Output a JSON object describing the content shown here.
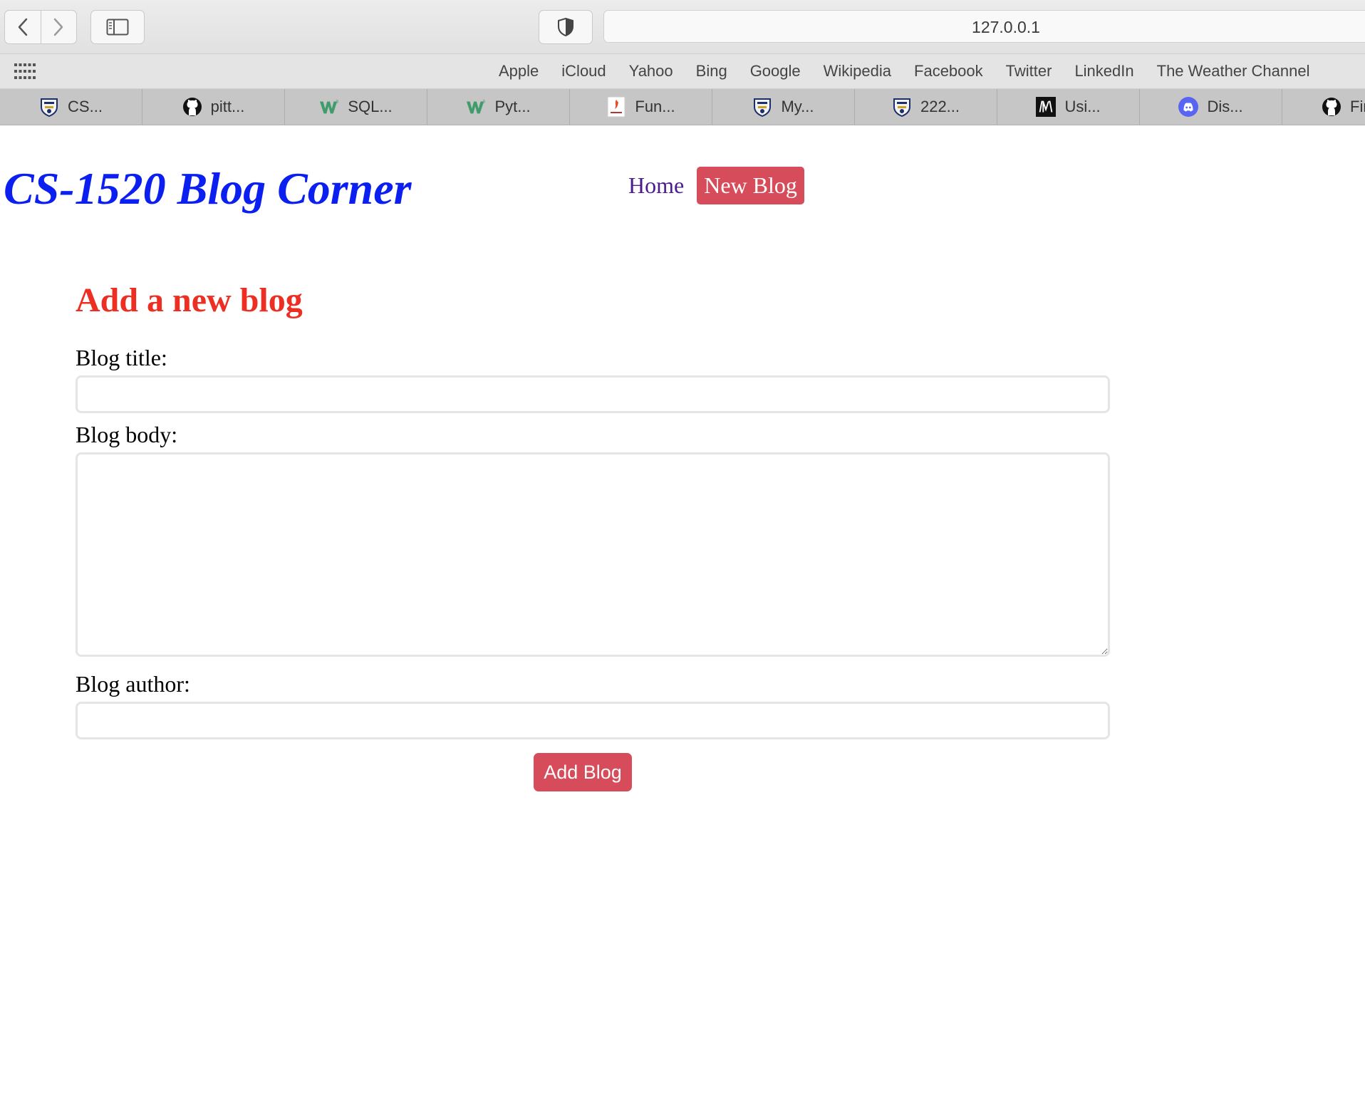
{
  "browser": {
    "address": "127.0.0.1",
    "favorites": [
      "Apple",
      "iCloud",
      "Yahoo",
      "Bing",
      "Google",
      "Wikipedia",
      "Facebook",
      "Twitter",
      "LinkedIn",
      "The Weather Channel"
    ],
    "tabs": [
      {
        "label": "CS...",
        "icon": "university-shield-icon"
      },
      {
        "label": "pitt...",
        "icon": "github-icon"
      },
      {
        "label": "SQL...",
        "icon": "w3schools-icon"
      },
      {
        "label": "Pyt...",
        "icon": "w3schools-icon"
      },
      {
        "label": "Fun...",
        "icon": "book-cover-icon"
      },
      {
        "label": "My...",
        "icon": "university-shield-icon"
      },
      {
        "label": "222...",
        "icon": "university-shield-icon"
      },
      {
        "label": "Usi...",
        "icon": "medium-icon"
      },
      {
        "label": "Dis...",
        "icon": "discord-icon"
      },
      {
        "label": "Fin...",
        "icon": "github-icon"
      }
    ]
  },
  "site": {
    "title": "CS-1520 Blog Corner",
    "nav": {
      "home": "Home",
      "new_blog": "New Blog"
    }
  },
  "form": {
    "heading": "Add a new blog",
    "title_label": "Blog title:",
    "title_value": "",
    "body_label": "Blog body:",
    "body_value": "",
    "author_label": "Blog author:",
    "author_value": "",
    "submit_label": "Add Blog"
  },
  "colors": {
    "title": "#0b1ff0",
    "heading": "#ec2f22",
    "accent": "#d64c5a",
    "link": "#4b1c8f"
  }
}
